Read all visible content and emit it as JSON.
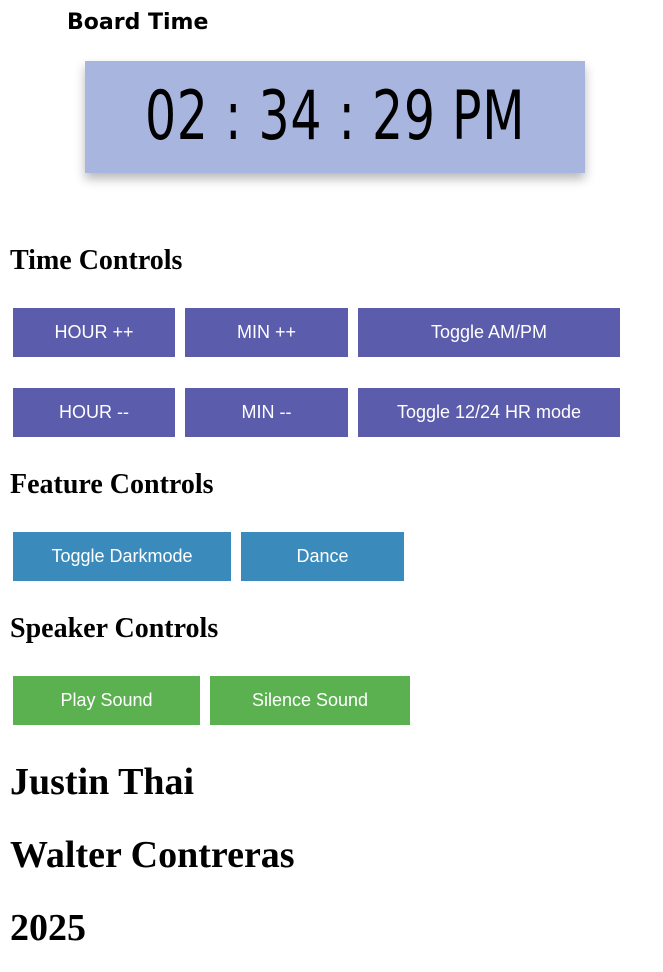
{
  "board": {
    "title": "Board Time",
    "time": "02 : 34 : 29 PM"
  },
  "time_controls": {
    "title": "Time Controls",
    "hour_up": "HOUR ++",
    "min_up": "MIN ++",
    "toggle_ampm": "Toggle AM/PM",
    "hour_down": "HOUR --",
    "min_down": "MIN --",
    "toggle_mode": "Toggle 12/24 HR mode"
  },
  "feature_controls": {
    "title": "Feature Controls",
    "toggle_darkmode": "Toggle Darkmode",
    "dance": "Dance"
  },
  "speaker_controls": {
    "title": "Speaker Controls",
    "play_sound": "Play Sound",
    "silence_sound": "Silence Sound"
  },
  "credits": {
    "author1": "Justin Thai",
    "author2": "Walter Contreras",
    "year": "2025"
  },
  "colors": {
    "clock_bg": "#a8b5df",
    "time_buttons": "#5b5cab",
    "feature_buttons": "#3a8bbb",
    "speaker_buttons": "#5bb150"
  }
}
